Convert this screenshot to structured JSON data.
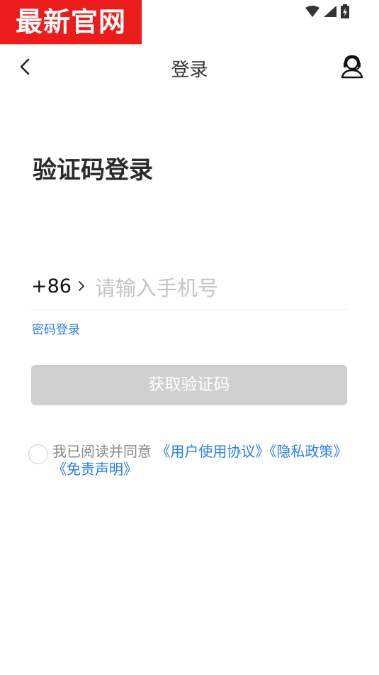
{
  "badge": {
    "text": "最新官网",
    "color": "#ec1c1c"
  },
  "status_bar": {
    "icons": [
      "wifi-icon",
      "cell-signal-icon",
      "battery-icon"
    ]
  },
  "nav": {
    "title": "登录",
    "back_icon": "chevron-left-icon",
    "service_icon": "customer-service-icon"
  },
  "heading": "验证码登录",
  "phone": {
    "country_code": "+86",
    "value": "",
    "placeholder": "请输入手机号"
  },
  "password_login_link": "密码登录",
  "get_code_button": "获取验证码",
  "agreement": {
    "checked": false,
    "prefix": "我已阅读并同意",
    "links": [
      "《用户使用协议》",
      "《隐私政策》",
      "《免责声明》"
    ]
  },
  "colors": {
    "link": "#2b7de9",
    "button_disabled": "#cfcfcf",
    "badge": "#ec1c1c"
  }
}
